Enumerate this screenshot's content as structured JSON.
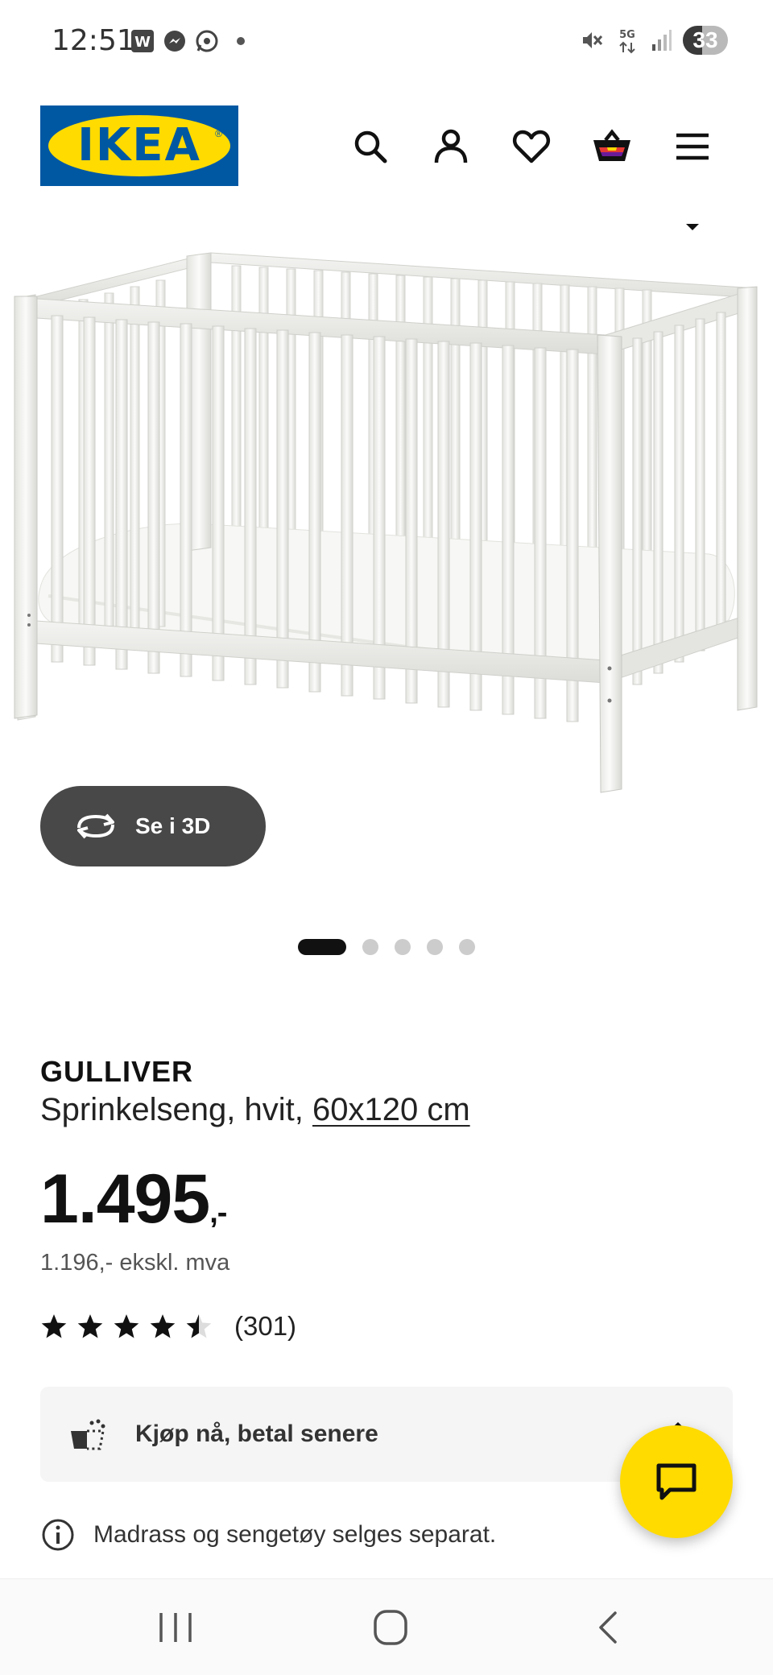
{
  "status_bar": {
    "time": "12:51",
    "app_icons": [
      "word-icon",
      "messenger-icon",
      "whatsapp-icon"
    ],
    "right_icons": [
      "mute-icon",
      "5g-icon",
      "signal-icon"
    ],
    "battery_level": "33"
  },
  "header": {
    "logo_text": "IKEA",
    "icons": [
      "search-icon",
      "account-icon",
      "heart-icon",
      "cart-icon",
      "menu-icon"
    ]
  },
  "gallery": {
    "see_3d_label": "Se i 3D",
    "image_count": 5,
    "active_index": 0
  },
  "product": {
    "name": "GULLIVER",
    "description": "Sprinkelseng, hvit,",
    "size": "60x120 cm",
    "price": "1.495",
    "price_suffix": ",-",
    "price_ex_vat": "1.196,- ekskl. mva",
    "rating": 4.5,
    "rating_count": "(301)"
  },
  "payment": {
    "label": "Kjøp nå, betal senere"
  },
  "note": {
    "text": "Madrass og sengetøy selges separat."
  },
  "colors": {
    "ikea_blue": "#0058a3",
    "ikea_yellow": "#ffdb00",
    "dark_button": "#484848"
  }
}
